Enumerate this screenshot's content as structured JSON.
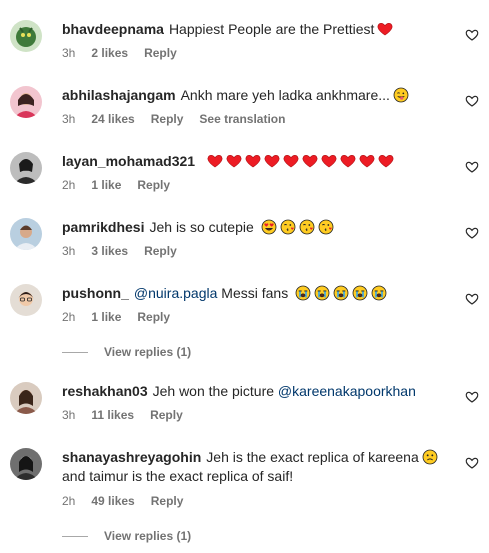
{
  "comments": [
    {
      "user": "bhavdeepnama",
      "text": "Happiest People are the Prettiest",
      "time": "3h",
      "likes": "2 likes",
      "reply": "Reply"
    },
    {
      "user": "abhilashajangam",
      "text": "Ankh mare yeh ladka ankhmare...",
      "time": "3h",
      "likes": "24 likes",
      "reply": "Reply",
      "translate": "See translation"
    },
    {
      "user": "layan_mohamad321",
      "text": "",
      "time": "2h",
      "likes": "1 like",
      "reply": "Reply"
    },
    {
      "user": "pamrikdhesi",
      "text": "Jeh is so cutepie",
      "time": "3h",
      "likes": "3 likes",
      "reply": "Reply"
    },
    {
      "user": "pushonn_",
      "mention": "@nuira.pagla",
      "text": "Messi fans",
      "time": "2h",
      "likes": "1 like",
      "reply": "Reply",
      "view_replies": "View replies (1)"
    },
    {
      "user": "reshakhan03",
      "text": "Jeh won the picture",
      "mention": "@kareenakapoorkhan",
      "time": "3h",
      "likes": "11 likes",
      "reply": "Reply"
    },
    {
      "user": "shanayashreyagohin",
      "text": "Jeh is the exact replica of kareena",
      "text2": "and taimur is the exact replica of saif!",
      "time": "2h",
      "likes": "49 likes",
      "reply": "Reply",
      "view_replies": "View replies (1)"
    }
  ],
  "icons": {
    "like": "heart-outline-icon",
    "heart_emoji": "red-heart-emoji",
    "wink_emoji": "winking-tongue-emoji",
    "heart_eyes": "heart-eyes-emoji",
    "kiss": "kiss-emoji",
    "crying": "crying-emoji",
    "sad": "sad-emoji"
  },
  "colors": {
    "text": "#262626",
    "meta": "#737373",
    "mention": "#00376b",
    "heart_red": "#ed1c24"
  }
}
